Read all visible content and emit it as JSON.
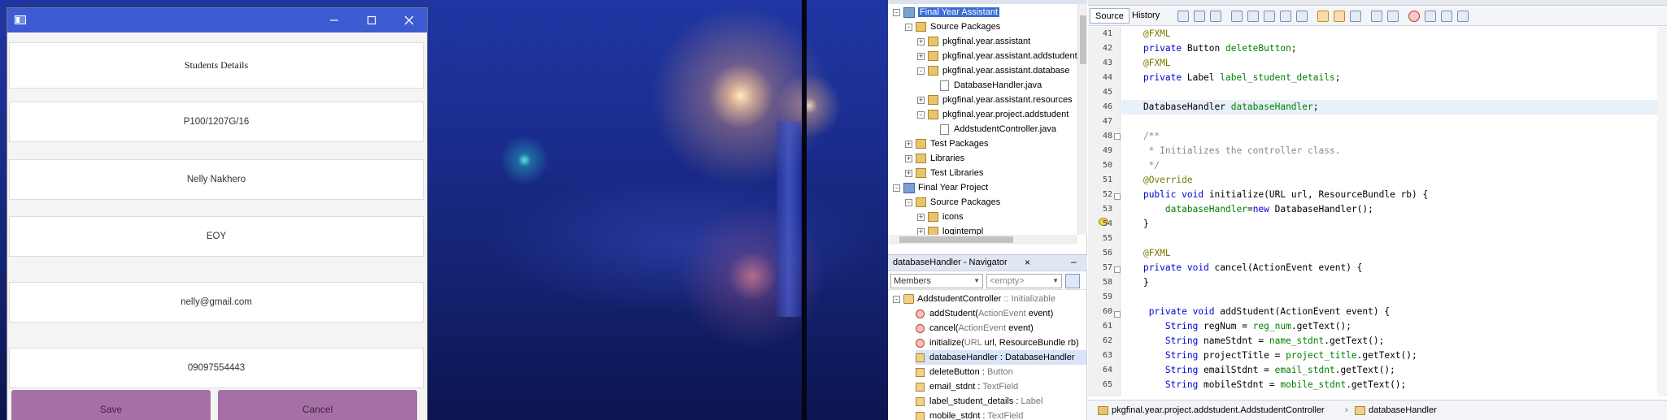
{
  "dialog": {
    "heading": "Students Details",
    "fields": {
      "reg_num": "P100/1207G/16",
      "name": "Nelly Nakhero",
      "project_title": "EOY",
      "email": "nelly@gmail.com",
      "mobile": "09097554443"
    },
    "save_label": "Save",
    "cancel_label": "Cancel"
  },
  "project_tree": [
    {
      "label": "Final Year Assistant",
      "indent": 0,
      "kind": "project",
      "toggle": "-",
      "selected": true
    },
    {
      "label": "Source Packages",
      "indent": 1,
      "kind": "package",
      "toggle": "-"
    },
    {
      "label": "pkgfinal.year.assistant",
      "indent": 2,
      "kind": "package",
      "toggle": "+"
    },
    {
      "label": "pkgfinal.year.assistant.addstudent",
      "indent": 2,
      "kind": "package",
      "toggle": "+"
    },
    {
      "label": "pkgfinal.year.assistant.database",
      "indent": 2,
      "kind": "package",
      "toggle": "-"
    },
    {
      "label": "DatabaseHandler.java",
      "indent": 3,
      "kind": "file",
      "toggle": ""
    },
    {
      "label": "pkgfinal.year.assistant.resources",
      "indent": 2,
      "kind": "package",
      "toggle": "+"
    },
    {
      "label": "pkgfinal.year.project.addstudent",
      "indent": 2,
      "kind": "package",
      "toggle": "-"
    },
    {
      "label": "AddstudentController.java",
      "indent": 3,
      "kind": "file",
      "toggle": ""
    },
    {
      "label": "Test Packages",
      "indent": 1,
      "kind": "package",
      "toggle": "+"
    },
    {
      "label": "Libraries",
      "indent": 1,
      "kind": "package",
      "toggle": "+"
    },
    {
      "label": "Test Libraries",
      "indent": 1,
      "kind": "package",
      "toggle": "+"
    },
    {
      "label": "Final Year Project",
      "indent": 0,
      "kind": "project",
      "toggle": "-"
    },
    {
      "label": "Source Packages",
      "indent": 1,
      "kind": "package",
      "toggle": "-"
    },
    {
      "label": "icons",
      "indent": 2,
      "kind": "package",
      "toggle": "+"
    },
    {
      "label": "logintempl",
      "indent": 2,
      "kind": "package",
      "toggle": "+"
    }
  ],
  "navigator": {
    "title": "databaseHandler - Navigator",
    "close_icon": "×",
    "minimize_icon": "–",
    "filter_label": "Members",
    "filter2_placeholder": "<empty>",
    "root": "AddstudentController",
    "root_type": ":: Initializable",
    "members": [
      {
        "kind": "method",
        "name": "addStudent(",
        "detail": "ActionEvent",
        "tail": " event)"
      },
      {
        "kind": "method",
        "name": "cancel(",
        "detail": "ActionEvent",
        "tail": " event)"
      },
      {
        "kind": "method",
        "name": "initialize(",
        "detail": "URL",
        "tail": " url, ResourceBundle rb)"
      },
      {
        "kind": "field",
        "name": "databaseHandler : DatabaseHandler",
        "detail": "",
        "tail": "",
        "selected": true
      },
      {
        "kind": "field",
        "name": "deleteButton : ",
        "detail": "Button",
        "tail": ""
      },
      {
        "kind": "field",
        "name": "email_stdnt : ",
        "detail": "TextField",
        "tail": ""
      },
      {
        "kind": "field",
        "name": "label_student_details : ",
        "detail": "Label",
        "tail": ""
      },
      {
        "kind": "field",
        "name": "mobile_stdnt : ",
        "detail": "TextField",
        "tail": ""
      }
    ]
  },
  "editor": {
    "tab_source": "Source",
    "tab_history": "History",
    "lines": [
      {
        "n": "41",
        "t": "    @FXML"
      },
      {
        "n": "42",
        "t": "    private Button deleteButton;"
      },
      {
        "n": "43",
        "t": "    @FXML"
      },
      {
        "n": "44",
        "t": "    private Label label_student_details;"
      },
      {
        "n": "45",
        "t": ""
      },
      {
        "n": "46",
        "t": "    DatabaseHandler databaseHandler;",
        "current": true
      },
      {
        "n": "47",
        "t": ""
      },
      {
        "n": "48",
        "t": "    /**"
      },
      {
        "n": "49",
        "t": "     * Initializes the controller class."
      },
      {
        "n": "50",
        "t": "     */"
      },
      {
        "n": "51",
        "t": "    @Override"
      },
      {
        "n": "52",
        "t": "    public void initialize(URL url, ResourceBundle rb) {"
      },
      {
        "n": "53",
        "t": "        databaseHandler=new DatabaseHandler();"
      },
      {
        "n": "54",
        "t": "    }"
      },
      {
        "n": "55",
        "t": ""
      },
      {
        "n": "56",
        "t": "    @FXML"
      },
      {
        "n": "57",
        "t": "    private void cancel(ActionEvent event) {"
      },
      {
        "n": "58",
        "t": "    }"
      },
      {
        "n": "59",
        "t": ""
      },
      {
        "n": "60",
        "t": "     private void addStudent(ActionEvent event) {"
      },
      {
        "n": "61",
        "t": "        String regNum = reg_num.getText();"
      },
      {
        "n": "62",
        "t": "        String nameStdnt = name_stdnt.getText();"
      },
      {
        "n": "63",
        "t": "        String projectTitle = project_title.getText();"
      },
      {
        "n": "64",
        "t": "        String emailStdnt = email_stdnt.getText();"
      },
      {
        "n": "65",
        "t": "        String mobileStdnt = mobile_stdnt.getText();"
      }
    ],
    "breadcrumb_class": "pkgfinal.year.project.addstudent.AddstudentController",
    "breadcrumb_member": "databaseHandler",
    "breadcrumb_sep": "›"
  }
}
